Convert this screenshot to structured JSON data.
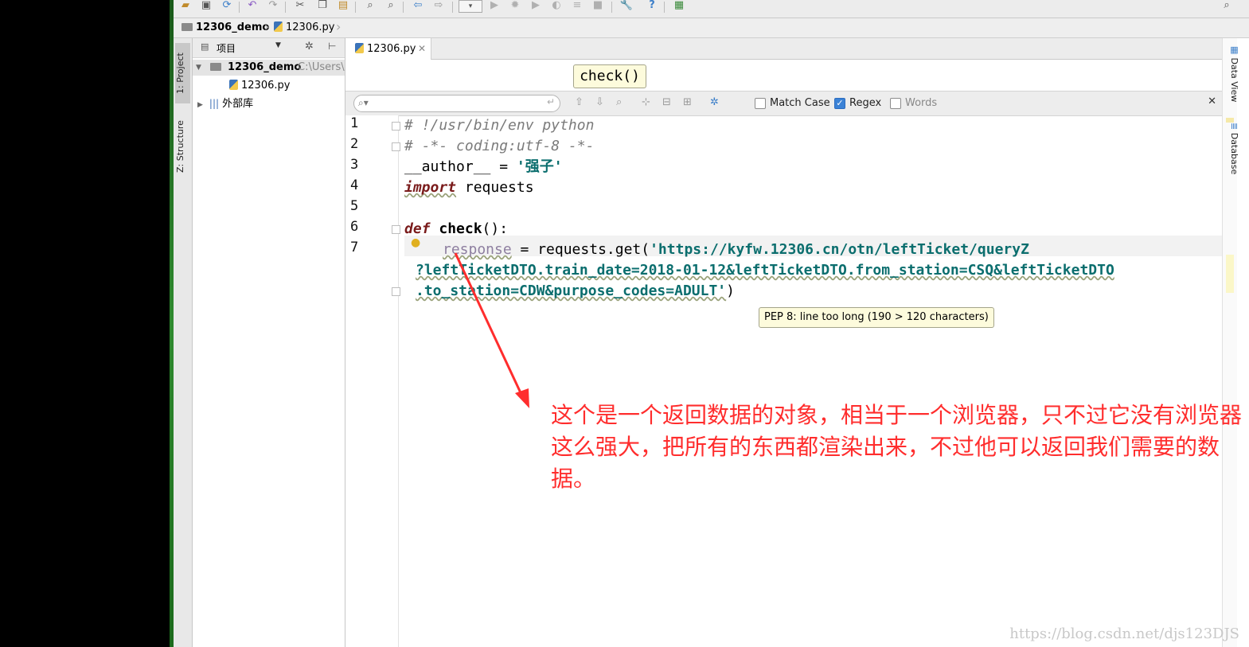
{
  "toolbar": {
    "icons": [
      "open-icon",
      "save-icon",
      "sync-icon",
      "undo-icon",
      "redo-icon",
      "cut-icon",
      "copy-icon",
      "paste-icon",
      "find-icon",
      "replace-icon",
      "back-icon",
      "forward-icon",
      "run-config-dropdown",
      "run-icon",
      "debug-icon",
      "coverage-icon",
      "profile-icon",
      "build-icon",
      "stop-icon",
      "settings-icon",
      "help-icon",
      "vcs-icon",
      "search-everywhere-icon"
    ]
  },
  "navbar": {
    "project": "12306_demo",
    "file": "12306.py"
  },
  "left_tool_windows": {
    "project_tab": "1: Project",
    "structure_tab": "Z: Structure"
  },
  "project_panel": {
    "view_label": "项目",
    "root_name": "12306_demo",
    "root_path": "C:\\Users\\",
    "file_name": "12306.py",
    "external_libs": "外部库"
  },
  "editor": {
    "tab_label": "12306.py",
    "tooltip_check": "check()",
    "find": {
      "match_case": "Match Case",
      "match_case_checked": false,
      "regex": "Regex",
      "regex_checked": true,
      "words": "Words",
      "words_checked": false
    },
    "line_numbers": [
      "1",
      "2",
      "3",
      "4",
      "5",
      "6",
      "7"
    ],
    "code": {
      "l1": "# !/usr/bin/env python",
      "l2": "# -*- coding:utf-8 -*-",
      "l3_a": "__author__ = ",
      "l3_b": "'强子'",
      "l4_kw": "import",
      "l4_rest": " requests",
      "l6_kw": "def",
      "l6_fn": "check",
      "l6_rest": "():",
      "l7_var": "response",
      "l7_mid": " = requests.get(",
      "l7_str": "'https://kyfw.12306.cn/otn/leftTicket/queryZ",
      "l8_str": "?leftTicketDTO.train_date=2018-01-12&leftTicketDTO.from_station=CSQ&leftTicketDTO",
      "l9_str": ".to_station=CDW&purpose_codes=ADULT'",
      "l9_end": ")"
    },
    "pep_tooltip": "PEP 8: line too long (190 > 120 characters)"
  },
  "right_tool_windows": {
    "data_view": "Data View",
    "database": "Database"
  },
  "annotation": {
    "text": "这个是一个返回数据的对象，相当于一个浏览器，只不过它没有浏览器这么强大，把所有的东西都渲染出来，不过他可以返回我们需要的数据。",
    "color": "#ff2d2d"
  },
  "watermark": "https://blog.csdn.net/djs123DJS"
}
